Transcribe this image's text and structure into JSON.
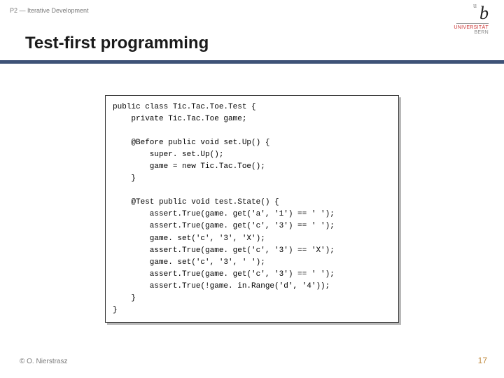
{
  "breadcrumb": "P2 — Iterative Development",
  "logo": {
    "sup": "u",
    "b": "b",
    "uni": "UNIVERSITÄT",
    "bern": "BERN"
  },
  "title": "Test-first programming",
  "code": "public class Tic.Tac.Toe.Test {\n    private Tic.Tac.Toe game;\n\n    @Before public void set.Up() {\n        super. set.Up();\n        game = new Tic.Tac.Toe();\n    }\n\n    @Test public void test.State() {\n        assert.True(game. get('a', '1') == ' ');\n        assert.True(game. get('c', '3') == ' ');\n        game. set('c', '3', 'X');\n        assert.True(game. get('c', '3') == 'X');\n        game. set('c', '3', ' ');\n        assert.True(game. get('c', '3') == ' ');\n        assert.True(!game. in.Range('d', '4'));\n    }\n}",
  "footer": {
    "left": "© O. Nierstrasz",
    "right": "17"
  }
}
